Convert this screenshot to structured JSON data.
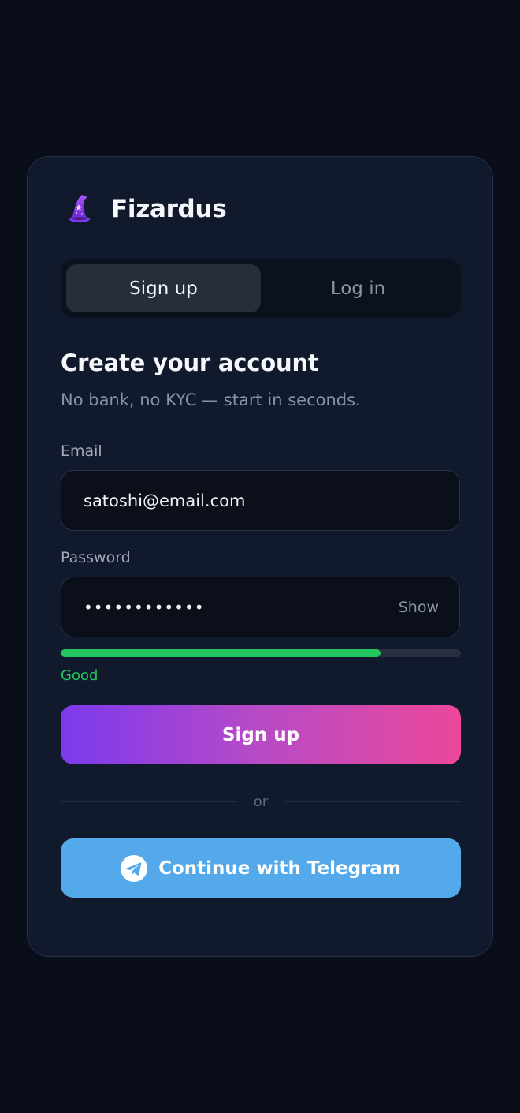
{
  "brand": {
    "name": "Fizardus",
    "logo_icon": "wizard-hat-icon"
  },
  "tabs": [
    {
      "label": "Sign up",
      "active": true
    },
    {
      "label": "Log in",
      "active": false
    }
  ],
  "form": {
    "heading": "Create your account",
    "subheading": "No bank, no KYC — start in seconds.",
    "email": {
      "label": "Email",
      "value": "satoshi@email.com"
    },
    "password": {
      "label": "Password",
      "value": "••••••••••••",
      "toggle_label": "Show"
    },
    "strength": {
      "label": "Good",
      "level": 0.8,
      "color": "#22c55e"
    },
    "submit_label": "Sign up"
  },
  "divider_text": "or",
  "telegram": {
    "label": "Continue with Telegram",
    "icon": "telegram-icon",
    "color": "#54a9eb"
  },
  "colors": {
    "background": "#090e1a",
    "card": "#111a2c",
    "accent_gradient_start": "#7c3aed",
    "accent_gradient_end": "#ec4899"
  }
}
